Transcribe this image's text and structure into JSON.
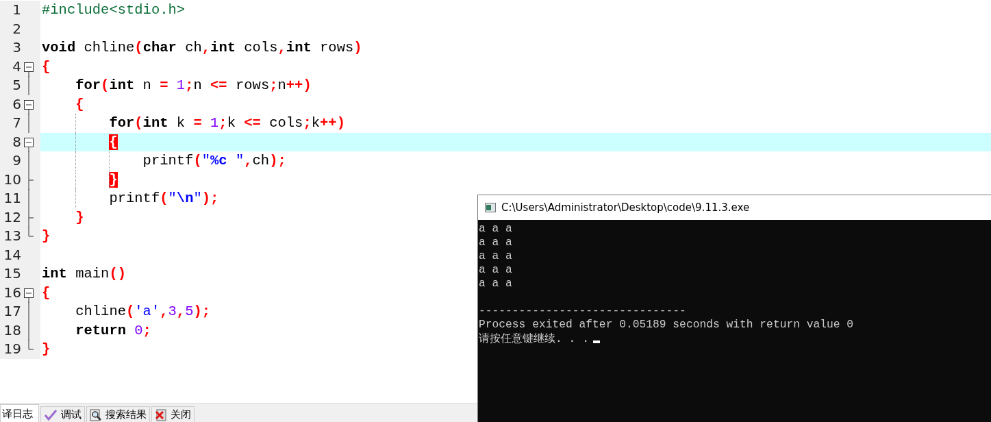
{
  "editor": {
    "lines": [
      {
        "number": "1",
        "kind": "plain",
        "current": false,
        "tokens": [
          {
            "t": "#include<stdio.h>",
            "kind": "pre"
          }
        ]
      },
      {
        "number": "2",
        "kind": "plain"
      },
      {
        "number": "3",
        "kind": "plain",
        "current": false,
        "tokens": [
          {
            "t": "void",
            "kind": "kw"
          },
          {
            "t": " chline",
            "kind": "plain"
          },
          {
            "t": "(",
            "kind": "op"
          },
          {
            "t": "char",
            "kind": "kw"
          },
          {
            "t": " ch",
            "kind": "plain"
          },
          {
            "t": ",",
            "kind": "op"
          },
          {
            "t": "int",
            "kind": "kw"
          },
          {
            "t": " cols",
            "kind": "plain"
          },
          {
            "t": ",",
            "kind": "op"
          },
          {
            "t": "int",
            "kind": "kw"
          },
          {
            "t": " rows",
            "kind": "plain"
          },
          {
            "t": ")",
            "kind": "op"
          }
        ]
      },
      {
        "number": "4",
        "kind": "box",
        "current": false,
        "tokens": [
          {
            "t": "{",
            "kind": "op"
          }
        ]
      },
      {
        "number": "5",
        "kind": "line",
        "current": false,
        "tokens": [
          {
            "t": "for",
            "kind": "kw"
          },
          {
            "t": "(",
            "kind": "op"
          },
          {
            "t": "int",
            "kind": "kw"
          },
          {
            "t": " n ",
            "kind": "plain"
          },
          {
            "t": "=",
            "kind": "op"
          },
          {
            "t": " 1",
            "kind": "num"
          },
          {
            "t": ";",
            "kind": "op"
          },
          {
            "t": "n ",
            "kind": "plain"
          },
          {
            "t": "<=",
            "kind": "op"
          },
          {
            "t": " rows",
            "kind": "plain"
          },
          {
            "t": ";",
            "kind": "op"
          },
          {
            "t": "n",
            "kind": "plain"
          },
          {
            "t": "++",
            "kind": "op"
          },
          {
            "t": ")",
            "kind": "op"
          }
        ]
      },
      {
        "number": "6",
        "kind": "box",
        "current": false,
        "tokens": [
          {
            "t": "{",
            "kind": "op"
          }
        ]
      },
      {
        "number": "7",
        "kind": "line",
        "current": false,
        "tokens": [
          {
            "t": "for",
            "kind": "kw"
          },
          {
            "t": "(",
            "kind": "op"
          },
          {
            "t": "int",
            "kind": "kw"
          },
          {
            "t": " k ",
            "kind": "plain"
          },
          {
            "t": "=",
            "kind": "op"
          },
          {
            "t": " 1",
            "kind": "num"
          },
          {
            "t": ";",
            "kind": "op"
          },
          {
            "t": "k ",
            "kind": "plain"
          },
          {
            "t": "<=",
            "kind": "op"
          },
          {
            "t": " cols",
            "kind": "plain"
          },
          {
            "t": ";",
            "kind": "op"
          },
          {
            "t": "k",
            "kind": "plain"
          },
          {
            "t": "++",
            "kind": "op"
          },
          {
            "t": ")",
            "kind": "op"
          }
        ]
      },
      {
        "number": "8",
        "kind": "box",
        "current": true,
        "tokens": [
          {
            "t": "{",
            "kind": "match"
          }
        ]
      },
      {
        "number": "9",
        "kind": "line",
        "current": false,
        "tokens": [
          {
            "t": "printf",
            "kind": "plain"
          },
          {
            "t": "(",
            "kind": "op"
          },
          {
            "t": "\"",
            "kind": "str"
          },
          {
            "t": "%c",
            "kind": "strb"
          },
          {
            "t": " \"",
            "kind": "str"
          },
          {
            "t": ",",
            "kind": "op"
          },
          {
            "t": "ch",
            "kind": "plain"
          },
          {
            "t": ")",
            "kind": "op"
          },
          {
            "t": ";",
            "kind": "op"
          }
        ]
      },
      {
        "number": "10",
        "kind": "tick",
        "current": false,
        "tokens": [
          {
            "t": "}",
            "kind": "match"
          }
        ]
      },
      {
        "number": "11",
        "kind": "line",
        "current": false,
        "tokens": [
          {
            "t": "printf",
            "kind": "plain"
          },
          {
            "t": "(",
            "kind": "op"
          },
          {
            "t": "\"",
            "kind": "str"
          },
          {
            "t": "\\n",
            "kind": "strb"
          },
          {
            "t": "\"",
            "kind": "str"
          },
          {
            "t": ")",
            "kind": "op"
          },
          {
            "t": ";",
            "kind": "op"
          }
        ]
      },
      {
        "number": "12",
        "kind": "tick",
        "current": false,
        "tokens": [
          {
            "t": "}",
            "kind": "op"
          }
        ]
      },
      {
        "number": "13",
        "kind": "end",
        "current": false,
        "tokens": [
          {
            "t": "}",
            "kind": "op"
          }
        ]
      },
      {
        "number": "14",
        "kind": "plain"
      },
      {
        "number": "15",
        "kind": "plain",
        "current": false,
        "tokens": [
          {
            "t": "int",
            "kind": "kw"
          },
          {
            "t": " main",
            "kind": "plain"
          },
          {
            "t": "()",
            "kind": "op"
          }
        ]
      },
      {
        "number": "16",
        "kind": "box",
        "current": false,
        "tokens": [
          {
            "t": "{",
            "kind": "op"
          }
        ]
      },
      {
        "number": "17",
        "kind": "line",
        "current": false,
        "tokens": [
          {
            "t": "chline",
            "kind": "plain"
          },
          {
            "t": "(",
            "kind": "op"
          },
          {
            "t": "'a'",
            "kind": "str"
          },
          {
            "t": ",",
            "kind": "op"
          },
          {
            "t": "3",
            "kind": "num"
          },
          {
            "t": ",",
            "kind": "op"
          },
          {
            "t": "5",
            "kind": "num"
          },
          {
            "t": ")",
            "kind": "op"
          },
          {
            "t": ";",
            "kind": "op"
          }
        ]
      },
      {
        "number": "18",
        "kind": "line",
        "current": false,
        "tokens": [
          {
            "t": "return",
            "kind": "kw"
          },
          {
            "t": " 0",
            "kind": "num"
          },
          {
            "t": ";",
            "kind": "op"
          }
        ]
      },
      {
        "number": "19",
        "kind": "end",
        "current": false,
        "tokens": [
          {
            "t": "}",
            "kind": "op"
          }
        ]
      }
    ]
  },
  "bottom_tabs": [
    {
      "label": "译日志",
      "kind": "plain",
      "selected": true
    },
    {
      "label": "调试",
      "kind": "check",
      "selected": false
    },
    {
      "label": "搜索结果",
      "kind": "search",
      "selected": false
    },
    {
      "label": "关闭",
      "kind": "close",
      "selected": false
    }
  ],
  "console": {
    "title": "C:\\Users\\Administrator\\Desktop\\code\\9.11.3.exe",
    "output": [
      "a a a",
      "a a a",
      "a a a",
      "a a a",
      "a a a"
    ],
    "summary": [
      "-------------------------------",
      "Process exited after 0.05189 seconds with return value 0",
      "请按任意键继续. . ."
    ]
  }
}
